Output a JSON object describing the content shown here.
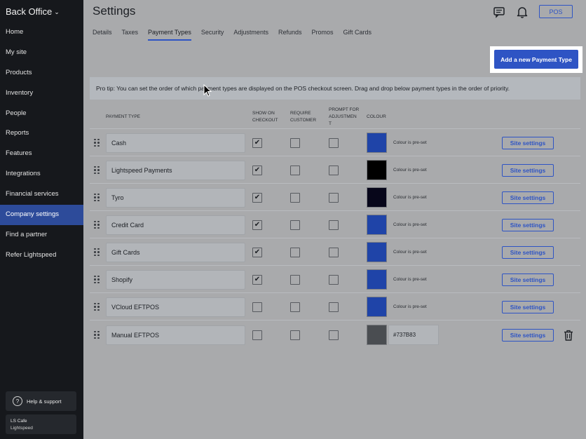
{
  "sidebar": {
    "brand": "Back Office",
    "items": [
      {
        "label": "Home"
      },
      {
        "label": "My site"
      },
      {
        "label": "Products"
      },
      {
        "label": "Inventory"
      },
      {
        "label": "People"
      },
      {
        "label": "Reports"
      },
      {
        "label": "Features"
      },
      {
        "label": "Integrations"
      },
      {
        "label": "Financial services"
      },
      {
        "label": "Company settings",
        "active": true
      },
      {
        "label": "Find a partner"
      },
      {
        "label": "Refer Lightspeed"
      }
    ],
    "help_label": "Help & support",
    "account": {
      "name": "LS Cafe",
      "location": "Lightspeed"
    }
  },
  "header": {
    "title": "Settings",
    "pos_label": "POS",
    "icons": [
      "chat-icon",
      "bell-icon"
    ]
  },
  "tabs": [
    {
      "label": "Details"
    },
    {
      "label": "Taxes"
    },
    {
      "label": "Payment Types",
      "active": true
    },
    {
      "label": "Security"
    },
    {
      "label": "Adjustments"
    },
    {
      "label": "Refunds"
    },
    {
      "label": "Promos"
    },
    {
      "label": "Gift Cards"
    }
  ],
  "add_button_label": "Add a new Payment Type",
  "pro_tip": "Pro tip: You can set the order of which payment types are displayed on the POS checkout screen. Drag and drop below payment types in the order of priority.",
  "table": {
    "headers": {
      "payment_type": "PAYMENT TYPE",
      "show_on_checkout_1": "SHOW ON",
      "show_on_checkout_2": "CHECKOUT",
      "require_customer_1": "REQUIRE",
      "require_customer_2": "CUSTOMER",
      "prompt_1": "PROMPT FOR",
      "prompt_2": "ADJUSTMEN",
      "prompt_3": "T",
      "colour": "COLOUR"
    },
    "preset_text": "Colour is pre-set",
    "site_settings_label": "Site settings",
    "rows": [
      {
        "name": "Cash",
        "show": true,
        "require": false,
        "prompt": false,
        "colour": "#1f44a8",
        "preset": true
      },
      {
        "name": "Lightspeed Payments",
        "show": true,
        "require": false,
        "prompt": false,
        "colour": "#000000",
        "preset": true
      },
      {
        "name": "Tyro",
        "show": true,
        "require": false,
        "prompt": false,
        "colour": "#07061a",
        "preset": true
      },
      {
        "name": "Credit Card",
        "show": true,
        "require": false,
        "prompt": false,
        "colour": "#1f44a8",
        "preset": true
      },
      {
        "name": "Gift Cards",
        "show": true,
        "require": false,
        "prompt": false,
        "colour": "#1f44a8",
        "preset": true
      },
      {
        "name": "Shopify",
        "show": true,
        "require": false,
        "prompt": false,
        "colour": "#1f44a8",
        "preset": true
      },
      {
        "name": "VCloud EFTPOS",
        "show": false,
        "require": false,
        "prompt": false,
        "colour": "#1f44a8",
        "preset": true
      },
      {
        "name": "Manual EFTPOS",
        "show": false,
        "require": false,
        "prompt": false,
        "colour": "#4a4d51",
        "preset": false,
        "hex": "#737B83",
        "deletable": true
      }
    ]
  }
}
